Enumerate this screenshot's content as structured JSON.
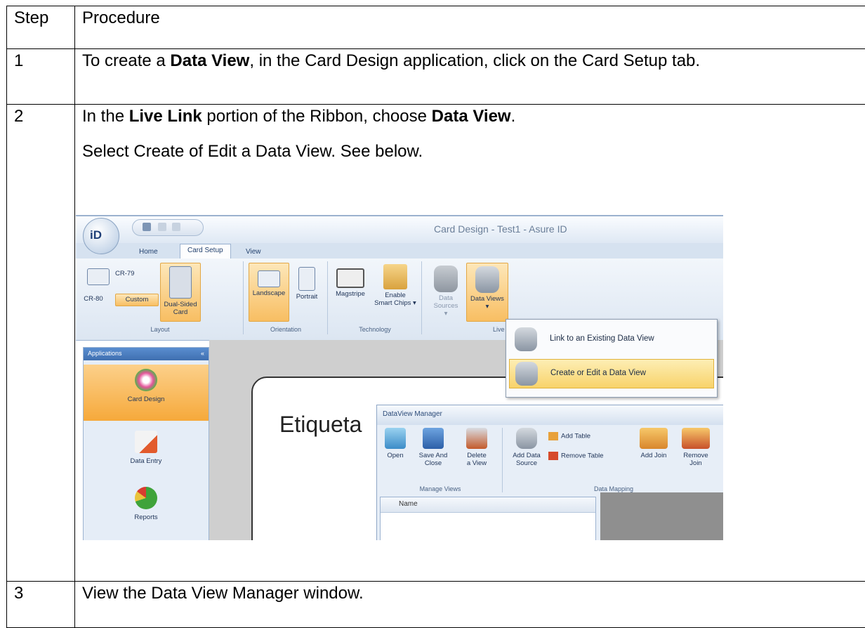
{
  "table": {
    "header": {
      "step": "Step",
      "procedure": "Procedure"
    },
    "row1": {
      "step": "1",
      "pre": "To create a ",
      "bold": "Data View",
      "post": ", in the Card Design application, click on the Card Setup tab."
    },
    "row2": {
      "step": "2",
      "pre": "In the ",
      "bold1": "Live Link",
      "mid": " portion of the Ribbon, choose ",
      "bold2": "Data View",
      "end": ".",
      "line2": "Select Create of Edit a Data View. See below."
    },
    "row3": {
      "step": "3",
      "text": "View the Data View Manager window."
    }
  },
  "screenshot": {
    "window_title": "Card Design - Test1 - Asure ID",
    "logo": "iD",
    "tabs": [
      "Home",
      "Card Setup",
      "View"
    ],
    "ribbon": {
      "layout": {
        "cr79": "CR-79",
        "cr80": "CR-80",
        "custom": "Custom",
        "dual1": "Dual-Sided",
        "dual2": "Card",
        "label": "Layout"
      },
      "orientation": {
        "landscape": "Landscape",
        "portrait": "Portrait",
        "label": "Orientation"
      },
      "technology": {
        "magstripe": "Magstripe",
        "enable1": "Enable",
        "enable2": "Smart Chips ▾",
        "label": "Technology"
      },
      "live_link": {
        "data_sources": "Data Sources",
        "data_views": "Data Views",
        "arrow": "▾",
        "label": "Live L"
      }
    },
    "dropdown": {
      "item1": "Link to an Existing Data View",
      "item2": "Create or Edit a Data View"
    },
    "sidebar": {
      "header": "Applications",
      "pin": "«",
      "items": [
        "Card Design",
        "Data Entry",
        "Reports"
      ]
    },
    "canvas_text": "Etiqueta",
    "dataview_manager": {
      "title": "DataView Manager",
      "open": "Open",
      "save1": "Save And",
      "save2": "Close",
      "delete1": "Delete",
      "delete2": "a View",
      "group1": "Manage Views",
      "add_source1": "Add Data",
      "add_source2": "Source",
      "add_table": "Add Table",
      "remove_table": "Remove Table",
      "add_join": "Add Join",
      "remove_join1": "Remove",
      "remove_join2": "Join",
      "group2": "Data Mapping",
      "list_header": "Name"
    }
  }
}
